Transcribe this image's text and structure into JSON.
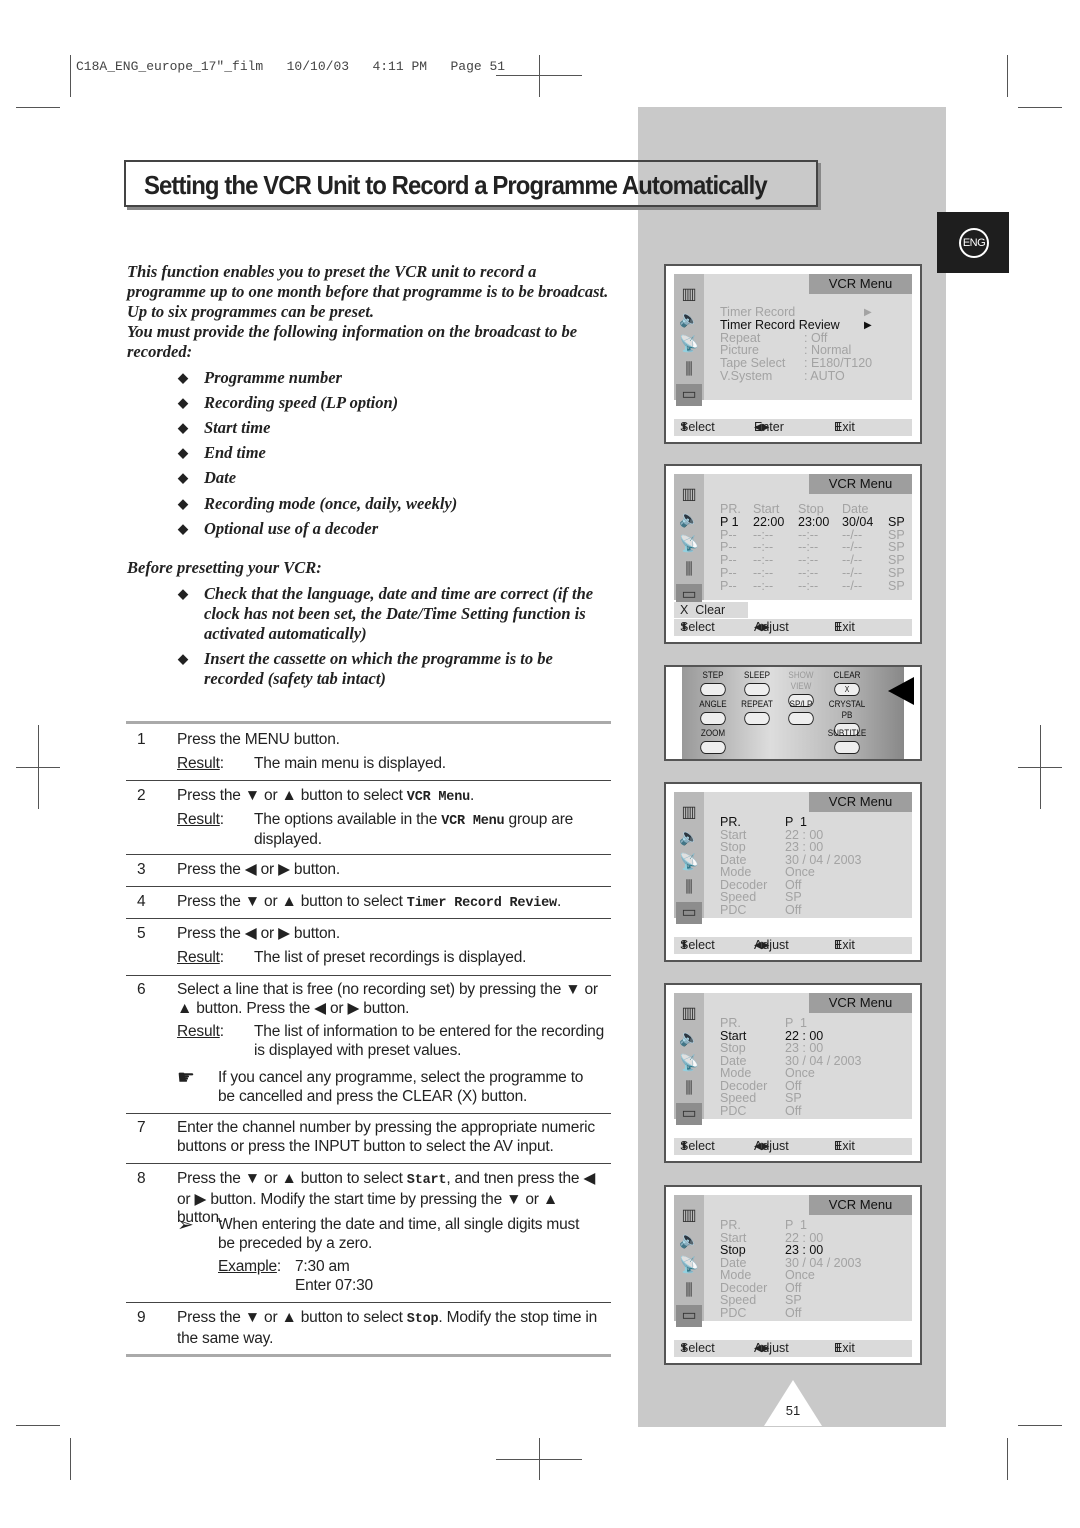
{
  "print_header": "C18A_ENG_europe_17\"_film   10/10/03   4:11 PM   Page 51",
  "language_tab": "ENG",
  "title": "Setting the VCR Unit to Record a Programme Automatically",
  "intro_1": "This function enables you to preset the VCR unit to record a programme up to one month before that programme is to be broadcast. Up to six programmes can be preset.",
  "intro_2": "You must provide the following information on the broadcast to be recorded:",
  "bullet_glyph": "◆",
  "info_items": [
    "Programme number",
    "Recording speed (LP option)",
    "Start time",
    "End time",
    "Date",
    "Recording mode (once, daily, weekly)",
    "Optional use of a decoder"
  ],
  "before_heading": "Before presetting your VCR:",
  "before_items": [
    "Check that the language, date and time are correct (if the clock has not been set, the Date/Time Setting function is activated automatically)",
    "Insert the cassette on which the programme is to be recorded (safety tab intact)"
  ],
  "steps": [
    {
      "num": "1",
      "lines": [
        [
          {
            "t": "Press the MENU button."
          }
        ]
      ],
      "result": "The main menu is displayed."
    },
    {
      "num": "2",
      "lines": [
        [
          {
            "t": "Press the ▼ or ▲ button to select "
          },
          {
            "t": "VCR Menu",
            "mono": true
          },
          {
            "t": "."
          }
        ]
      ],
      "result_parts": [
        {
          "t": "The options available in the "
        },
        {
          "t": "VCR Menu",
          "mono": true
        },
        {
          "t": " group are displayed."
        }
      ]
    },
    {
      "num": "3",
      "lines": [
        [
          {
            "t": "Press the ◀ or ▶ button."
          }
        ]
      ]
    },
    {
      "num": "4",
      "lines": [
        [
          {
            "t": "Press the ▼ or ▲ button to select "
          },
          {
            "t": "Timer Record Review",
            "mono": true
          },
          {
            "t": "."
          }
        ]
      ]
    },
    {
      "num": "5",
      "lines": [
        [
          {
            "t": "Press the ◀ or ▶ button."
          }
        ]
      ],
      "result": "The list of preset recordings is displayed."
    },
    {
      "num": "6",
      "lines": [
        [
          {
            "t": "Select a line that is free (no recording set) by pressing the ▼ or ▲ button. Press the ◀ or ▶ button."
          }
        ]
      ],
      "result": "The list of information to be entered for the recording is displayed with preset values.",
      "note_icon": "☛",
      "note": "If you cancel any programme, select the programme to be cancelled and press the CLEAR (X) button."
    },
    {
      "num": "7",
      "lines": [
        [
          {
            "t": "Enter the channel number by pressing the appropriate numeric buttons or press the INPUT button to select the AV input."
          }
        ]
      ]
    },
    {
      "num": "8",
      "lines": [
        [
          {
            "t": "Press the ▼ or ▲ button to select "
          },
          {
            "t": "Start",
            "mono": true
          },
          {
            "t": ", and tnen press the ◀ or ▶ button.  Modify the start time by pressing the ▼ or ▲ button."
          }
        ]
      ],
      "note_icon": "➢",
      "note": "When entering the date and time, all single digits must be preceded by a zero.",
      "example_label": "Example",
      "example_value": "7:30 am",
      "example_enter": "Enter 07:30"
    },
    {
      "num": "9",
      "lines": [
        [
          {
            "t": "Press the ▼ or ▲ button to select "
          },
          {
            "t": "Stop",
            "mono": true
          },
          {
            "t": ". Modify the stop time in the same way."
          }
        ]
      ]
    }
  ],
  "result_label": "Result",
  "screens": {
    "menu_title": "VCR Menu",
    "s1": {
      "rows": [
        [
          "Timer Record",
          "",
          "▶"
        ],
        [
          "Timer Record Review",
          "",
          "▶"
        ],
        [
          "Repeat",
          ": Off",
          ""
        ],
        [
          "Picture",
          ": Normal",
          ""
        ],
        [
          "Tape Select",
          ": E180/T120",
          ""
        ],
        [
          "V.System",
          ": AUTO",
          ""
        ]
      ],
      "active": 1,
      "footer": [
        "Select",
        "Enter",
        "Exit"
      ]
    },
    "s2": {
      "head": [
        "PR.",
        "Start",
        "Stop",
        "Date",
        ""
      ],
      "rows": [
        [
          "P 1",
          "22:00",
          "23:00",
          "30/04",
          "SP"
        ],
        [
          "P--",
          "--:--",
          "--:--",
          "--/--",
          "SP"
        ],
        [
          "P--",
          "--:--",
          "--:--",
          "--/--",
          "SP"
        ],
        [
          "P--",
          "--:--",
          "--:--",
          "--/--",
          "SP"
        ],
        [
          "P--",
          "--:--",
          "--:--",
          "--/--",
          "SP"
        ],
        [
          "P--",
          "--:--",
          "--:--",
          "--/--",
          "SP"
        ]
      ],
      "clear": "X  Clear",
      "footer": [
        "Select",
        "Adjust",
        "Exit"
      ]
    },
    "detail_labels": [
      "PR.",
      "Start",
      "Stop",
      "Date",
      "Mode",
      "Decoder",
      "Speed",
      "PDC"
    ],
    "detail_values": [
      "P  1",
      "22 : 00",
      "23 : 00",
      "30 / 04 / 2003",
      "Once",
      "Off",
      "SP",
      "Off"
    ],
    "s3_active": 0,
    "s4_active": 1,
    "s5_active": 2,
    "footer": [
      "Select",
      "Adjust",
      "Exit"
    ]
  },
  "remote_buttons": [
    [
      "STEP",
      "SLEEP",
      "SHOW VIEW",
      "CLEAR"
    ],
    [
      "ANGLE",
      "REPEAT",
      "SP/LP",
      "CRYSTAL PB"
    ],
    [
      "ZOOM",
      "",
      "",
      "SUBTITLE"
    ]
  ],
  "clear_key_label": "X",
  "page_number": "51"
}
